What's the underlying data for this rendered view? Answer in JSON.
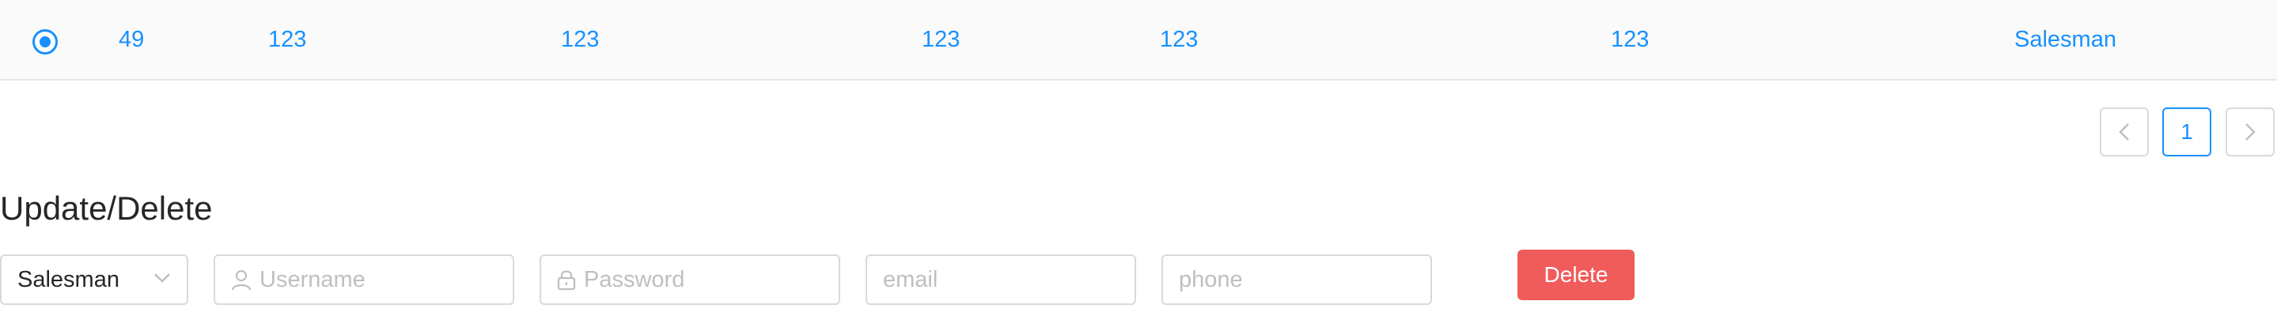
{
  "table_row": {
    "selected": true,
    "cells": [
      "49",
      "123",
      "123",
      "123",
      "123",
      "123",
      "Salesman"
    ]
  },
  "pagination": {
    "prev_icon": "chevron-left-icon",
    "current_page": "1",
    "next_icon": "chevron-right-icon"
  },
  "section": {
    "title": "Update/Delete"
  },
  "form": {
    "role_select_value": "Salesman",
    "username_placeholder": "Username",
    "password_placeholder": "Password",
    "email_placeholder": "email",
    "phone_placeholder": "phone",
    "delete_label": "Delete"
  },
  "colors": {
    "primary": "#1890ff",
    "danger": "#f05c5c",
    "border": "#d9d9d9",
    "row_bg": "#fafafa"
  }
}
